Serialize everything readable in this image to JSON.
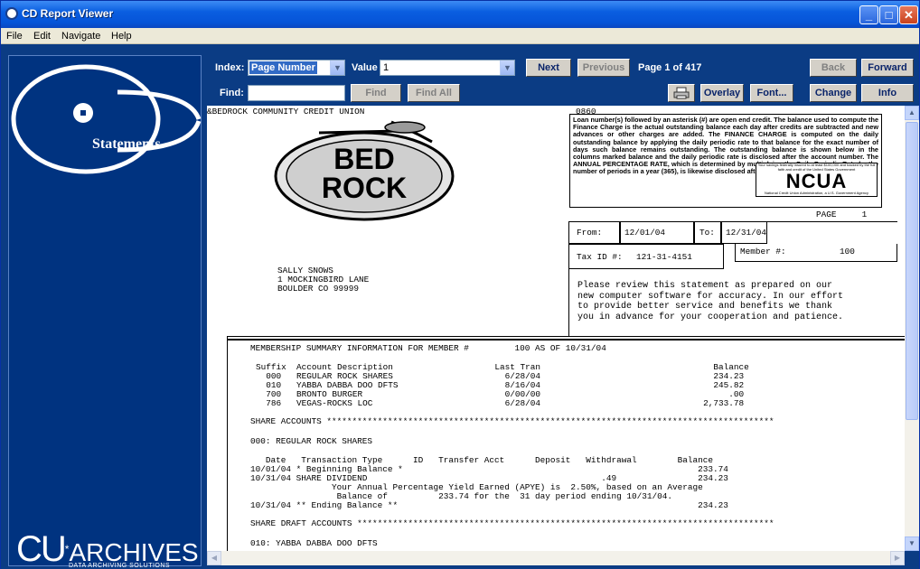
{
  "window": {
    "title": "CD Report Viewer"
  },
  "menu": [
    "File",
    "Edit",
    "Navigate",
    "Help"
  ],
  "sidebar": {
    "statements_label": "Statements",
    "brand_main": "ARCHIVES",
    "brand_cu": "CU",
    "brand_sub": "DATA ARCHIVING SOLUTIONS"
  },
  "toolbar": {
    "index_label": "Index:",
    "index_value": "Page Number",
    "value_label": "Value",
    "value_value": "1",
    "next": "Next",
    "previous": "Previous",
    "page_info": "Page 1 of 417",
    "back": "Back",
    "forward": "Forward",
    "find_label": "Find:",
    "find_value": "",
    "find_btn": "Find",
    "find_all": "Find All",
    "overlay": "Overlay",
    "font": "Font...",
    "change": "Change",
    "info": "Info"
  },
  "report": {
    "bank_name": "&BEDROCK COMMUNITY CREDIT UNION",
    "code": "0860",
    "logo_top": "BED",
    "logo_bottom": "ROCK",
    "disclaimer": "Loan number(s) followed by an asterisk (#) are open end credit.  The balance used to compute the Finance Charge is the actual outstanding balance each day after credits are subtracted and new advances or other charges are added.  The FINANCE CHARGE is computed on the daily outstanding balance by applying the daily periodic rate to that balance for the exact number of days such balance remains outstanding.  The outstanding balance is shown below in the columns marked balance and the daily periodic rate is disclosed after the account number.  The ANNUAL PERCENTAGE RATE, which is determined by multiplying the Daily Periodic Rate by the number of periods in a year (365), is likewise disclosed after the account number.",
    "ncua_top": "Your savings federally insured to at least $100,000 and backed by the full faith and credit of the United States Government",
    "ncua_big": "NCUA",
    "ncua_bottom": "National Credit Union Administration, a U.S. Government Agency",
    "page_label": "PAGE     1",
    "from_label": "From:",
    "from_value": "12/01/04",
    "to_label": "To:",
    "to_value": "12/31/04",
    "member_label": "Member #:",
    "member_value": "100",
    "taxid_label": "Tax ID #:",
    "taxid_value": "121-31-4151",
    "addr1": "SALLY SNOWS",
    "addr2": "1 MOCKINGBIRD LANE",
    "addr3": "BOULDER CO 99999",
    "notice": "Please review this statement as prepared on our\nnew computer software for accuracy. In our effort\nto provide better service and benefits we thank\nyou in advance for your cooperation and patience.",
    "summary_header": "MEMBERSHIP SUMMARY INFORMATION FOR MEMBER #         100 AS OF 10/31/04",
    "summary_cols": "Suffix  Account Description                    Last Tran                                  Balance",
    "summary_rows": [
      "  000   REGULAR ROCK SHARES                      6/28/04                                  234.23",
      "  010   YABBA DABBA DOO DFTS                     8/16/04                                  245.82",
      "  700   BRONTO BURGER                            0/00/00                                     .00",
      "  786   VEGAS-ROCKS LOC                          6/28/04                                2,733.78"
    ],
    "share_accounts": "SHARE ACCOUNTS ****************************************************************************************",
    "acct_000": "000: REGULAR ROCK SHARES",
    "txn_cols": "   Date   Transaction Type      ID   Transfer Acct      Deposit   Withdrawal        Balance",
    "txn_lines": [
      "10/01/04 * Beginning Balance *                                                          233.74",
      "10/31/04 SHARE DIVIDEND                                              .49                234.23",
      "                Your Annual Percentage Yield Earned (APYE) is  2.50%, based on an Average",
      "                 Balance of          233.74 for the  31 day period ending 10/31/04.",
      "10/31/04 ** Ending Balance **                                                           234.23"
    ],
    "share_draft": "SHARE DRAFT ACCOUNTS **********************************************************************************",
    "acct_010": "010: YABBA DABBA DOO DFTS"
  }
}
